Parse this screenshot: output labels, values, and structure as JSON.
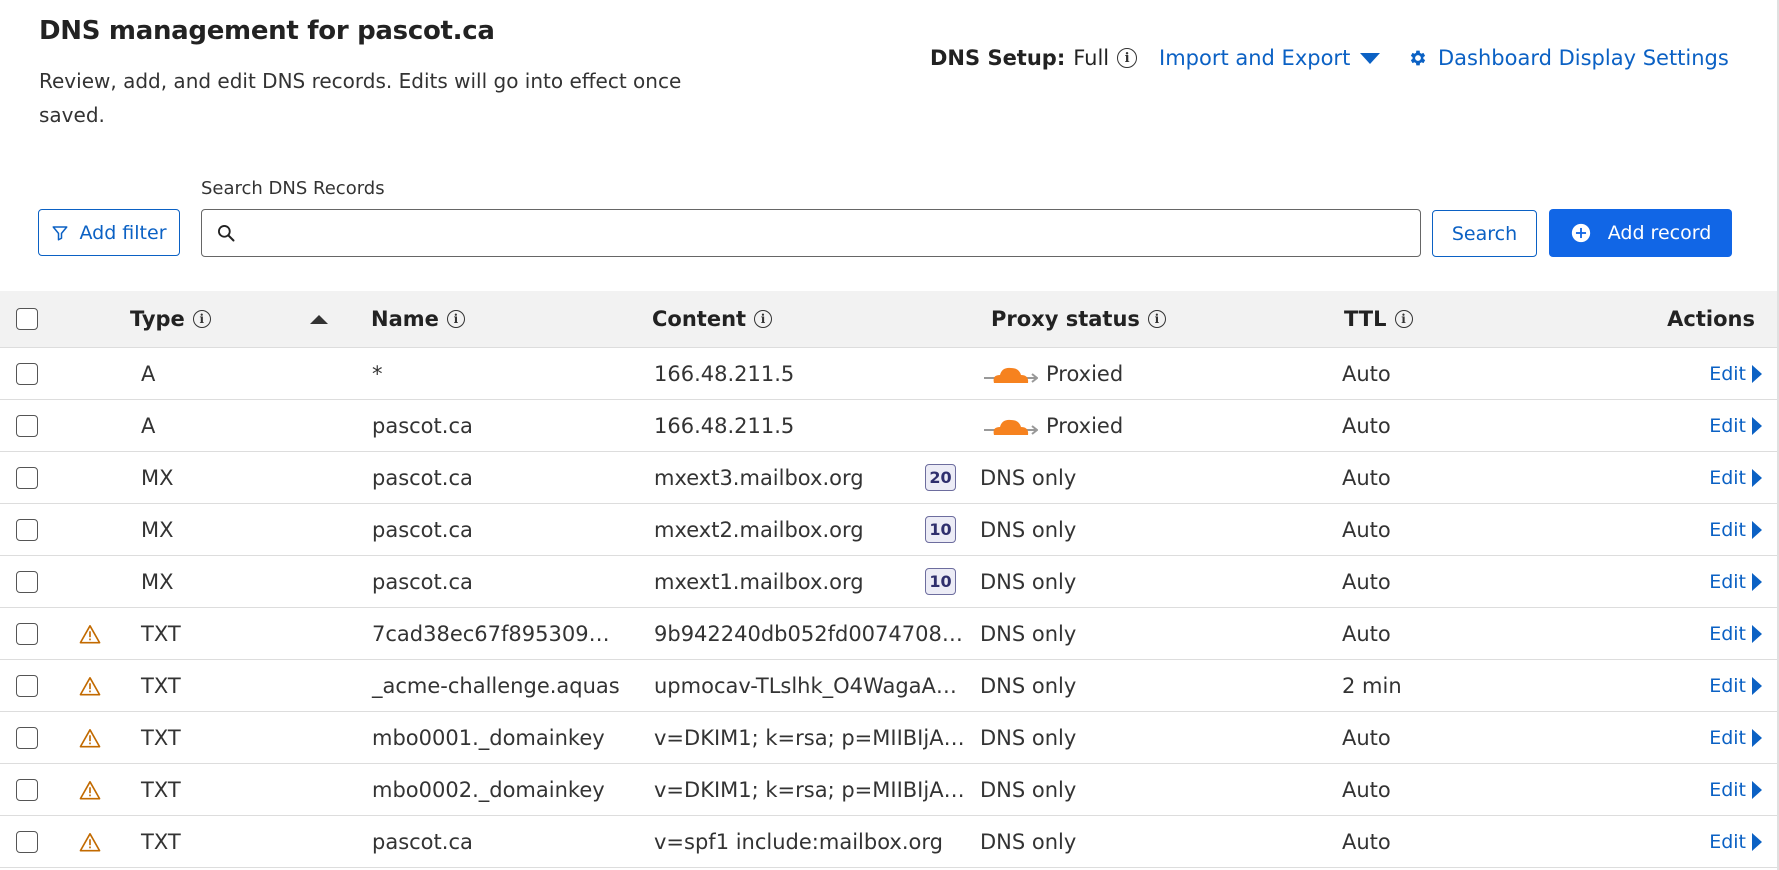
{
  "header": {
    "title_prefix": "DNS management for ",
    "title_domain": "pascot.ca",
    "description": "Review, add, and edit DNS records. Edits will go into effect once saved.",
    "dns_setup_label": "DNS Setup:",
    "dns_setup_value": "Full",
    "import_export": "Import and Export",
    "dashboard_settings": "Dashboard Display Settings"
  },
  "toolbar": {
    "search_label": "Search DNS Records",
    "search_placeholder": "",
    "add_filter": "Add filter",
    "search_button": "Search",
    "add_record": "Add record"
  },
  "table": {
    "headers": {
      "type": "Type",
      "name": "Name",
      "content": "Content",
      "proxy": "Proxy status",
      "ttl": "TTL",
      "actions": "Actions"
    },
    "edit_label": "Edit",
    "rows": [
      {
        "warning": false,
        "type": "A",
        "name": "*",
        "content": "166.48.211.5",
        "priority": "",
        "proxy": "Proxied",
        "proxied": true,
        "ttl": "Auto"
      },
      {
        "warning": false,
        "type": "A",
        "name": "pascot.ca",
        "content": "166.48.211.5",
        "priority": "",
        "proxy": "Proxied",
        "proxied": true,
        "ttl": "Auto"
      },
      {
        "warning": false,
        "type": "MX",
        "name": "pascot.ca",
        "content": "mxext3.mailbox.org",
        "priority": "20",
        "proxy": "DNS only",
        "proxied": false,
        "ttl": "Auto"
      },
      {
        "warning": false,
        "type": "MX",
        "name": "pascot.ca",
        "content": "mxext2.mailbox.org",
        "priority": "10",
        "proxy": "DNS only",
        "proxied": false,
        "ttl": "Auto"
      },
      {
        "warning": false,
        "type": "MX",
        "name": "pascot.ca",
        "content": "mxext1.mailbox.org",
        "priority": "10",
        "proxy": "DNS only",
        "proxied": false,
        "ttl": "Auto"
      },
      {
        "warning": true,
        "type": "TXT",
        "name": "7cad38ec67f895309…",
        "content": "9b942240db052fd0074708…",
        "priority": "",
        "proxy": "DNS only",
        "proxied": false,
        "ttl": "Auto"
      },
      {
        "warning": true,
        "type": "TXT",
        "name": "_acme-challenge.aquas",
        "content": "upmocav-TLslhk_O4WagaA…",
        "priority": "",
        "proxy": "DNS only",
        "proxied": false,
        "ttl": "2 min"
      },
      {
        "warning": true,
        "type": "TXT",
        "name": "mbo0001._domainkey",
        "content": "v=DKIM1; k=rsa; p=MIIBIjA…",
        "priority": "",
        "proxy": "DNS only",
        "proxied": false,
        "ttl": "Auto"
      },
      {
        "warning": true,
        "type": "TXT",
        "name": "mbo0002._domainkey",
        "content": "v=DKIM1; k=rsa; p=MIIBIjA…",
        "priority": "",
        "proxy": "DNS only",
        "proxied": false,
        "ttl": "Auto"
      },
      {
        "warning": true,
        "type": "TXT",
        "name": "pascot.ca",
        "content": "v=spf1 include:mailbox.org",
        "priority": "",
        "proxy": "DNS only",
        "proxied": false,
        "ttl": "Auto"
      }
    ]
  },
  "colors": {
    "accent": "#0b61c4",
    "primary_button": "#1166e6",
    "cloud": "#f6821f",
    "warning": "#c26a00"
  },
  "icons": {
    "info": "info-circle-icon",
    "gear": "gear-icon",
    "filter": "funnel-icon",
    "search": "magnifier-icon",
    "add": "plus-circle-icon",
    "warning": "warning-triangle-icon",
    "proxied": "orange-cloud-icon"
  }
}
